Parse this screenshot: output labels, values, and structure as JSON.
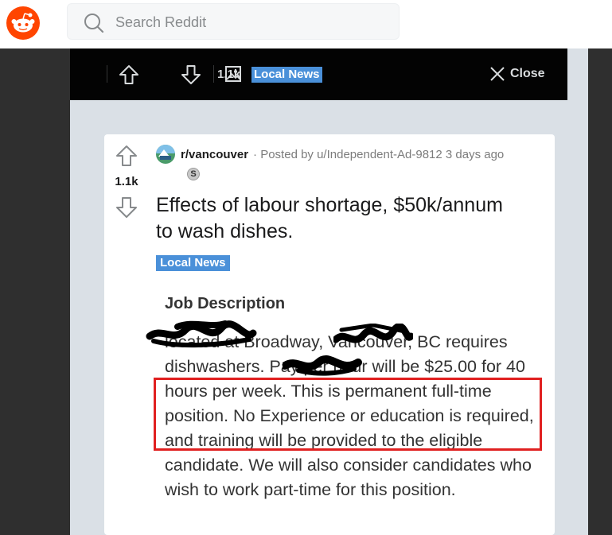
{
  "header": {
    "search_placeholder": "Search Reddit",
    "logo_icon": "reddit-logo-icon",
    "search_icon": "search-icon"
  },
  "media_bar": {
    "vote_count": "1.1k",
    "flair": "Local News",
    "close_label": "Close",
    "icons": [
      "upvote-icon",
      "downvote-icon",
      "image-post-icon",
      "close-icon"
    ]
  },
  "post": {
    "vote_count": "1.1k",
    "subreddit": "r/vancouver",
    "posted_by": "· Posted by u/Independent-Ad-9812 3 days ago",
    "award_glyph": "S",
    "title": "Effects of labour shortage, $50k/annum to wash dishes.",
    "flair": "Local News",
    "flair_color": "#4a90d9"
  },
  "image_content": {
    "heading": "Job Description",
    "body": "located at Broadway, Vancouver, BC requires dishwashers. Pay per hour will be $25.00 for 40 hours per week. This is permanent full-time position. No Experience or education is required, and training will be provided to the eligible candidate. We will also consider candidates who wish to work part-time for this position.",
    "highlight_color": "#e02020"
  }
}
